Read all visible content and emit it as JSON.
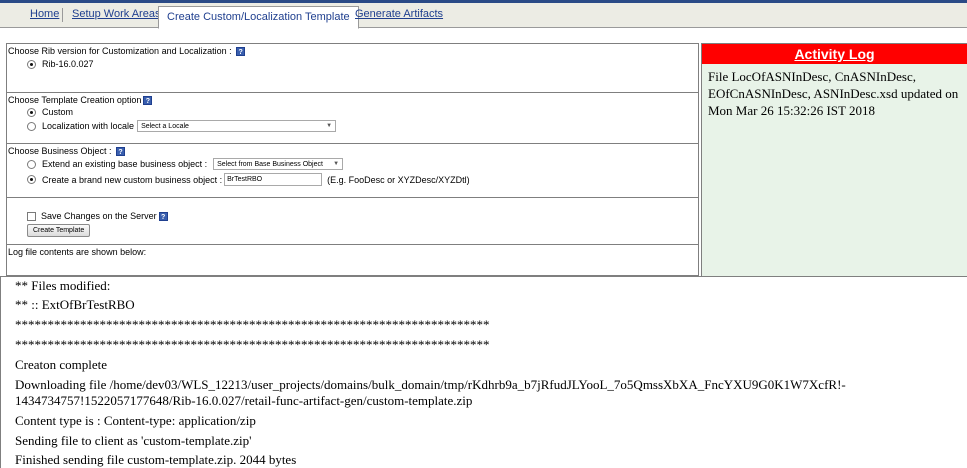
{
  "tabs": [
    {
      "label": "Home"
    },
    {
      "label": "Setup Work Areas"
    },
    {
      "label": "Create Custom/Localization Template"
    },
    {
      "label": "Generate Artifacts"
    }
  ],
  "rib_section": {
    "title": "Choose Rib version for Customization and Localization : ",
    "option": "Rib-16.0.027"
  },
  "template_section": {
    "title": "Choose Template Creation option",
    "custom_label": "Custom",
    "localization_label": "Localization with locale",
    "locale_select": "Select a Locale"
  },
  "business_section": {
    "title": "Choose Business Object : ",
    "extend_label": "Extend an existing base business object : ",
    "extend_select": "Select from Base Business Object",
    "create_label": "Create a brand new custom business object : ",
    "create_value": "BrTestRBO",
    "create_hint": "(E.g. FooDesc or XYZDesc/XYZDtl)"
  },
  "save_section": {
    "save_label": "Save Changes on the Server",
    "create_button": "Create Template"
  },
  "log_section": {
    "caption": "Log file contents are shown below:"
  },
  "activity_log": {
    "title": "Activity Log",
    "lines": [
      "File LocOfASNInDesc, CnASNInDesc,",
      "EOfCnASNInDesc, ASNInDesc.xsd updated on",
      "Mon Mar 26 15:32:26 IST 2018"
    ]
  },
  "log_lines": [
    "** Files modified:",
    "** :: ExtOfBrTestRBO",
    "*************************************************************************",
    "*************************************************************************",
    "Creaton complete",
    "Downloading file /home/dev03/WLS_12213/user_projects/domains/bulk_domain/tmp/rKdhrb9a_b7jRfudJLYooL_7o5QmssXbXA_FncYXU9G0K1W7XcfR!-",
    "1434734757!1522057177648/Rib-16.0.027/retail-func-artifact-gen/custom-template.zip",
    "Content type is : Content-type: application/zip",
    "Sending file to client as 'custom-template.zip'",
    "Finished sending file custom-template.zip. 2044 bytes"
  ],
  "icons": {
    "help": "help-icon",
    "dropdown": "chevron-down-icon"
  },
  "colors": {
    "nav_link": "#1f3f8f",
    "activity_header": "#ff0000",
    "activity_body": "#e8f3e8"
  }
}
